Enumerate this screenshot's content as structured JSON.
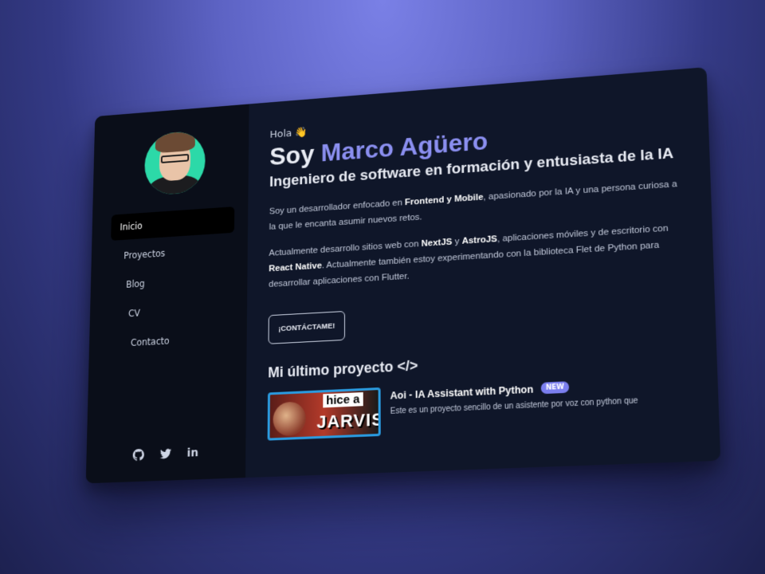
{
  "sidebar": {
    "nav": [
      {
        "label": "Inicio",
        "active": true
      },
      {
        "label": "Proyectos",
        "active": false
      },
      {
        "label": "Blog",
        "active": false
      },
      {
        "label": "CV",
        "active": false
      },
      {
        "label": "Contacto",
        "active": false
      }
    ],
    "socials": [
      {
        "icon": "github-icon"
      },
      {
        "icon": "twitter-icon"
      },
      {
        "icon": "linkedin-icon",
        "text": "in"
      }
    ]
  },
  "hero": {
    "greeting": "Hola",
    "greeting_emoji": "👋",
    "title_prefix": "Soy ",
    "name": "Marco Agüero",
    "subtitle": "Ingeniero de software en formación y entusiasta de la IA"
  },
  "about": {
    "p1_a": "Soy un desarrollador enfocado en ",
    "p1_b": "Frontend y Mobile",
    "p1_c": ", apasionado por la IA y una persona curiosa a la que le encanta asumir nuevos retos.",
    "p2_a": "Actualmente desarrollo sitios web con ",
    "p2_b": "NextJS",
    "p2_c": " y ",
    "p2_d": "AstroJS",
    "p2_e": ", aplicaciones móviles y de escritorio con ",
    "p2_f": "React Native",
    "p2_g": ". Actualmente también estoy experimentando con la biblioteca Flet de Python para desarrollar aplicaciones con Flutter."
  },
  "contact_button": "¡CONTÁCTAME!",
  "latest": {
    "section_title": "Mi último proyecto </>",
    "project_title": "Aoi - IA Assistant with Python",
    "badge": "NEW",
    "description": "Este es un proyecto sencillo de un asistente por voz con python que",
    "thumb_text_1": "hice a",
    "thumb_text_2": "JARVIS"
  },
  "colors": {
    "accent": "#8b8ff0",
    "avatar_bg": "#2cd9a8",
    "sidebar_bg": "#0a0e19",
    "main_bg": "#0f1629"
  }
}
